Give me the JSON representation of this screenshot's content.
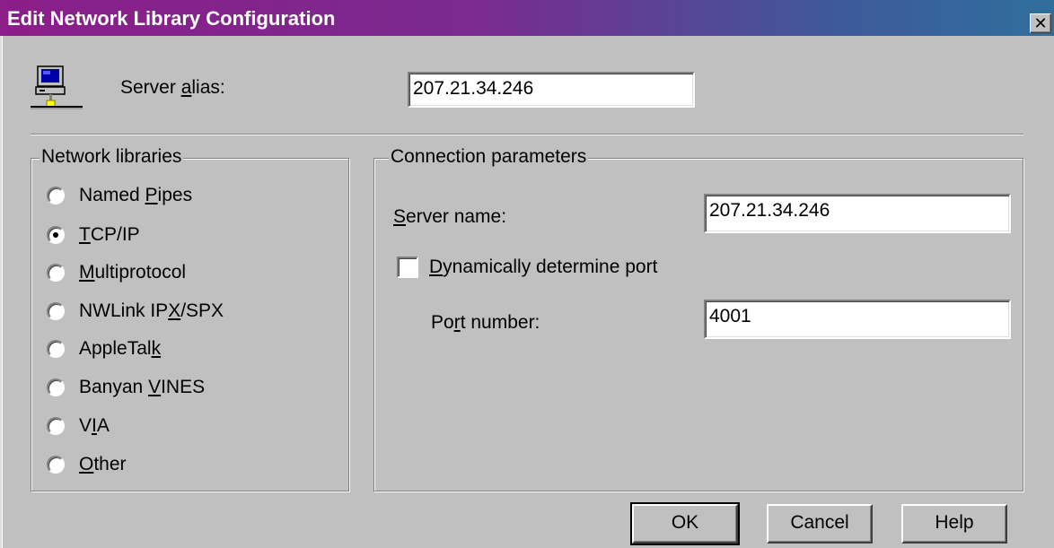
{
  "window": {
    "title": "Edit Network Library Configuration",
    "close_glyph": "✕"
  },
  "icons": {
    "server": "computer-network-icon"
  },
  "server_alias": {
    "label_pre": "Server ",
    "label_key": "a",
    "label_post": "lias:",
    "value": "207.21.34.246"
  },
  "network_libraries": {
    "title": "Network libraries",
    "selected": "TCP/IP",
    "options": [
      {
        "pre": "Named ",
        "key": "P",
        "post": "ipes"
      },
      {
        "pre": "",
        "key": "T",
        "post": "CP/IP"
      },
      {
        "pre": "",
        "key": "M",
        "post": "ultiprotocol"
      },
      {
        "pre": "NWLink IP",
        "key": "X",
        "post": "/SPX"
      },
      {
        "pre": "AppleTal",
        "key": "k",
        "post": ""
      },
      {
        "pre": "Banyan ",
        "key": "V",
        "post": "INES"
      },
      {
        "pre": "V",
        "key": "I",
        "post": "A"
      },
      {
        "pre": "",
        "key": "O",
        "post": "ther"
      }
    ]
  },
  "connection_parameters": {
    "title": "Connection parameters",
    "server_name": {
      "label_pre": "",
      "label_key": "S",
      "label_post": "erver name:",
      "value": "207.21.34.246"
    },
    "dynamic_port": {
      "label_pre": "",
      "label_key": "D",
      "label_post": "ynamically determine port",
      "checked": false
    },
    "port_number": {
      "label_pre": "Po",
      "label_key": "r",
      "label_post": "t number:",
      "value": "4001"
    }
  },
  "buttons": {
    "ok": "OK",
    "cancel": "Cancel",
    "help": "Help"
  }
}
